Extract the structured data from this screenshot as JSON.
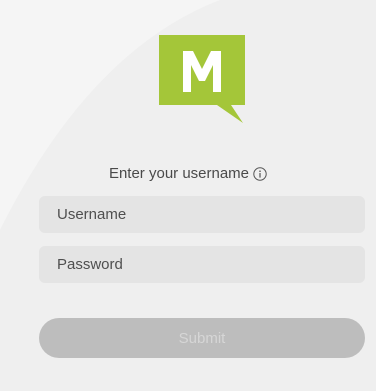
{
  "login": {
    "prompt": "Enter your username",
    "username_placeholder": "Username",
    "password_placeholder": "Password",
    "submit_label": "Submit"
  },
  "logo": {
    "letter": "M",
    "icon": "m-speech-bubble-logo"
  },
  "colors": {
    "logo_green": "#a4c639",
    "field_bg": "#e4e4e4",
    "submit_bg": "#bdbdbd",
    "page_bg": "#f2f2f2"
  }
}
